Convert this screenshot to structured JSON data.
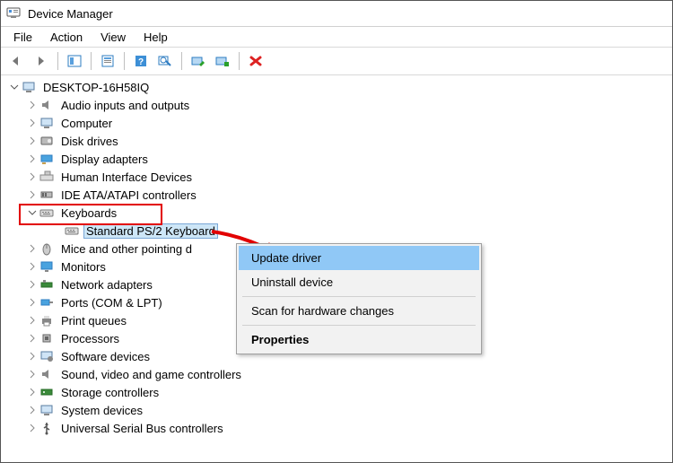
{
  "title": "Device Manager",
  "menu": {
    "file": "File",
    "action": "Action",
    "view": "View",
    "help": "Help"
  },
  "root": "DESKTOP-16H58IQ",
  "nodes": {
    "audio": "Audio inputs and outputs",
    "computer": "Computer",
    "disk": "Disk drives",
    "display": "Display adapters",
    "hid": "Human Interface Devices",
    "ide": "IDE ATA/ATAPI controllers",
    "keyboards": "Keyboards",
    "kb_child": "Standard PS/2 Keyboard",
    "mice": "Mice and other pointing d",
    "monitors": "Monitors",
    "net": "Network adapters",
    "ports": "Ports (COM & LPT)",
    "print": "Print queues",
    "proc": "Processors",
    "soft": "Software devices",
    "sound": "Sound, video and game controllers",
    "storage": "Storage controllers",
    "system": "System devices",
    "usb": "Universal Serial Bus controllers"
  },
  "context": {
    "update": "Update driver",
    "uninstall": "Uninstall device",
    "scan": "Scan for hardware changes",
    "props": "Properties"
  }
}
